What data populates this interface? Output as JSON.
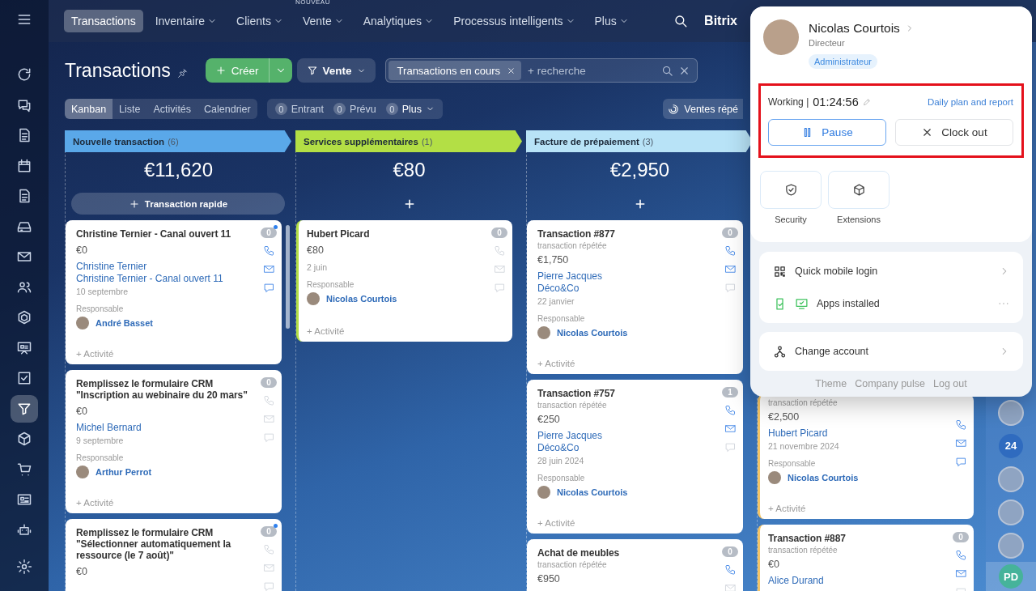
{
  "sidebar": {
    "items": [
      {
        "selected": false
      },
      {
        "selected": false
      },
      {
        "selected": false
      },
      {
        "selected": false
      },
      {
        "selected": false
      },
      {
        "selected": false
      },
      {
        "selected": false
      },
      {
        "selected": false
      },
      {
        "selected": false
      },
      {
        "selected": false
      },
      {
        "selected": false
      },
      {
        "selected": true
      },
      {
        "selected": false
      },
      {
        "selected": false
      },
      {
        "selected": false
      },
      {
        "selected": false
      }
    ]
  },
  "nav": {
    "items": [
      {
        "label": "Transactions",
        "selected": true,
        "dropdown": false
      },
      {
        "label": "Inventaire",
        "selected": false,
        "dropdown": true
      },
      {
        "label": "Clients",
        "selected": false,
        "dropdown": true
      },
      {
        "label": "Vente",
        "selected": false,
        "dropdown": true,
        "badge": "NOUVEAU"
      },
      {
        "label": "Analytiques",
        "selected": false,
        "dropdown": true
      },
      {
        "label": "Processus intelligents",
        "selected": false,
        "dropdown": true
      },
      {
        "label": "Plus",
        "selected": false,
        "dropdown": true
      }
    ],
    "brand": "Bitrix"
  },
  "header": {
    "title": "Transactions",
    "create_button": "Créer",
    "filter_button": "Vente",
    "search": {
      "chip": "Transactions en cours",
      "placeholder": "+ recherche"
    }
  },
  "views": [
    {
      "label": "Kanban",
      "selected": true
    },
    {
      "label": "Liste",
      "selected": false
    },
    {
      "label": "Activités",
      "selected": false
    },
    {
      "label": "Calendrier",
      "selected": false
    }
  ],
  "counters": [
    {
      "count": "0",
      "label": "Entrant",
      "dropdown": false
    },
    {
      "count": "0",
      "label": "Prévu",
      "dropdown": false
    },
    {
      "count": "0",
      "label": "Plus",
      "dropdown": true
    }
  ],
  "repeat_button": "Ventes répé",
  "columns": [
    {
      "title": "Nouvelle transaction",
      "count": "(6)",
      "color": "#5aa8e9",
      "total": "€11,620",
      "add_label": "Transaction rapide",
      "cards": [
        {
          "title": "Christine Ternier - Canal ouvert 11",
          "amount": "€0",
          "contacts": [
            "Christine Ternier",
            "Christine Ternier - Canal ouvert 11"
          ],
          "date": "10 septembre",
          "responsible_label": "Responsable",
          "responsible": "André Basset",
          "activity": "+ Activité",
          "badge": "0",
          "badge_dot": true,
          "phone": true,
          "mail": true,
          "chat": true,
          "accent": false
        },
        {
          "title": "Remplissez le formulaire CRM \"Inscription au webinaire du 20 mars\"",
          "amount": "€0",
          "contacts": [
            "Michel Bernard"
          ],
          "date": "9 septembre",
          "responsible_label": "Responsable",
          "responsible": "Arthur Perrot",
          "activity": "+ Activité",
          "badge": "0",
          "badge_dot": false,
          "phone": false,
          "mail": false,
          "chat": false,
          "accent": false
        },
        {
          "title": "Remplissez le formulaire CRM \"Sélectionner automatiquement la ressource (le 7 août)\"",
          "amount": "€0",
          "badge": "0",
          "badge_dot": true,
          "phone": false,
          "mail": false,
          "chat": false,
          "accent": false
        }
      ]
    },
    {
      "title": "Services supplémentaires",
      "count": "(1)",
      "color": "#b3df45",
      "total": "€80",
      "cards": [
        {
          "title": "Hubert Picard",
          "amount": "€80",
          "date": "2 juin",
          "responsible_label": "Responsable",
          "responsible": "Nicolas Courtois",
          "activity": "+ Activité",
          "badge": "0",
          "badge_dot": false,
          "phone": false,
          "mail": false,
          "chat": false,
          "accent": true
        }
      ]
    },
    {
      "title": "Facture de prépaiement",
      "count": "(3)",
      "color": "#b8e3f7",
      "total": "€2,950",
      "cards": [
        {
          "title": "Transaction #877",
          "subtitle": "transaction répétée",
          "amount": "€1,750",
          "contacts": [
            "Pierre Jacques",
            "Déco&Co"
          ],
          "date": "22 janvier",
          "responsible_label": "Responsable",
          "responsible": "Nicolas Courtois",
          "activity": "+ Activité",
          "badge": "0",
          "badge_dot": false,
          "phone": true,
          "mail": true,
          "chat": false,
          "accent": false
        },
        {
          "title": "Transaction #757",
          "subtitle": "transaction répétée",
          "amount": "€250",
          "contacts": [
            "Pierre Jacques",
            "Déco&Co"
          ],
          "date": "28 juin 2024",
          "responsible_label": "Responsable",
          "responsible": "Nicolas Courtois",
          "activity": "+ Activité",
          "badge": "1",
          "badge_dot": false,
          "phone": true,
          "mail": true,
          "chat": false,
          "accent": false
        },
        {
          "title": "Achat de meubles",
          "subtitle": "transaction répétée",
          "amount": "€950",
          "badge": "0",
          "badge_dot": false,
          "phone": true,
          "mail": false,
          "chat": false,
          "accent": false
        }
      ]
    },
    {
      "color": "#f3c467",
      "cards": [
        {
          "subtitle": "transaction répétée",
          "amount": "€2,500",
          "contacts": [
            "Hubert Picard"
          ],
          "date": "21 novembre 2024",
          "responsible_label": "Responsable",
          "responsible": "Nicolas Courtois",
          "activity": "+ Activité",
          "phone": true,
          "mail": true,
          "chat": true,
          "accent": true
        },
        {
          "title": "Transaction #887",
          "subtitle": "transaction répétée",
          "amount": "€0",
          "contacts": [
            "Alice Durand"
          ],
          "badge": "0",
          "badge_dot": false,
          "phone": true,
          "mail": true,
          "chat": false,
          "accent": true
        }
      ]
    }
  ],
  "right_bar": [
    {
      "kind": "photo",
      "selected": false
    },
    {
      "kind": "initials",
      "label": "24",
      "color": "#2f6bbf",
      "selected": false
    },
    {
      "kind": "photo",
      "selected": false
    },
    {
      "kind": "photo",
      "selected": false
    },
    {
      "kind": "photo",
      "selected": false
    },
    {
      "kind": "initials",
      "label": "PD",
      "color": "#46b39a",
      "selected": true
    }
  ],
  "profile": {
    "name": "Nicolas Courtois",
    "role": "Directeur",
    "badge": "Administrateur",
    "timer": {
      "status": "Working |",
      "time": "01:24:56",
      "link": "Daily plan and report",
      "pause": "Pause",
      "clock_out": "Clock out"
    },
    "tiles": [
      {
        "label": "Security"
      },
      {
        "label": "Extensions"
      }
    ],
    "menu": [
      {
        "label": "Quick mobile login"
      },
      {
        "label": "Apps installed"
      }
    ],
    "account": "Change account",
    "footer": [
      "Theme",
      "Company pulse",
      "Log out"
    ]
  }
}
